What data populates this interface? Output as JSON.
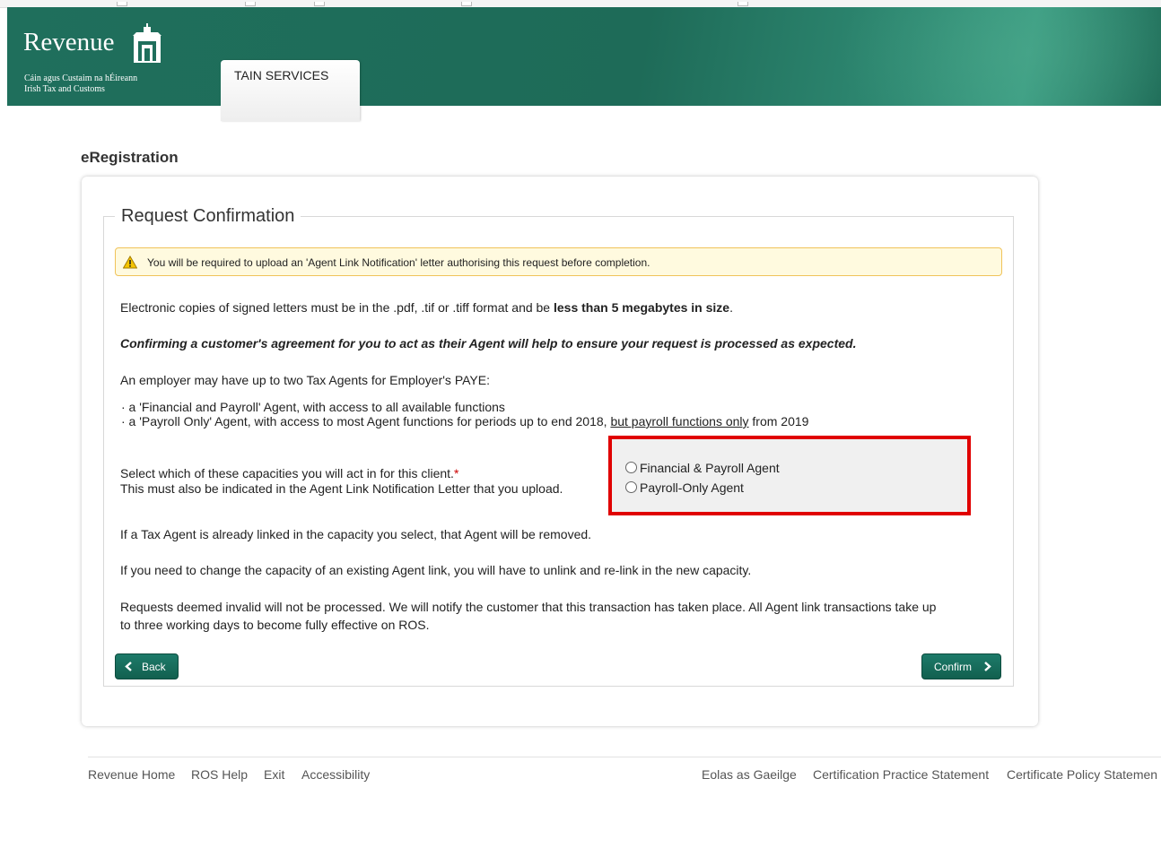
{
  "header": {
    "logo_word": "Revenue",
    "logo_sub1": "Cáin agus Custaim na hÉireann",
    "logo_sub2": "Irish Tax and Customs",
    "tab_label": "TAIN SERVICES"
  },
  "page": {
    "title": "eRegistration"
  },
  "form": {
    "legend": "Request Confirmation",
    "alert": "You will be required to upload an 'Agent Link Notification' letter authorising this request before completion.",
    "para1_a": "Electronic copies of signed letters must be in the .pdf, .tif or .tiff format and be ",
    "para1_b": "less than 5 megabytes in size",
    "para1_c": ".",
    "para2": "Confirming a customer's agreement for you to act as their Agent will help to ensure your request is processed as expected.",
    "para3": "An employer may have up to two Tax Agents for Employer's PAYE:",
    "bullet1": "· a 'Financial and Payroll' Agent, with access to all available functions",
    "bullet2_a": "· a 'Payroll Only' Agent, with access to most Agent functions for periods up to end 2018, ",
    "bullet2_b": "but payroll functions only",
    "bullet2_c": " from 2019",
    "select_label": "Select which of these capacities you will act in for this client.",
    "required_mark": "*",
    "select_label2": "This must also be indicated in the Agent Link Notification Letter that you upload.",
    "radio_options": [
      "Financial & Payroll Agent",
      "Payroll-Only Agent"
    ],
    "para4": "If a Tax Agent is already linked in the capacity you select, that Agent will be removed.",
    "para5": "If you need to change the capacity of an existing Agent link, you will have to unlink and re-link in the new capacity.",
    "para6_line1": "Requests deemed invalid will not be processed. We will notify the customer that this transaction has taken place. All Agent link transactions take up",
    "para6_line2": "to three working days to become fully effective on ROS.",
    "back_label": "Back",
    "confirm_label": "Confirm"
  },
  "footer": {
    "left_links": [
      "Revenue Home",
      "ROS Help",
      "Exit",
      "Accessibility"
    ],
    "right_links": [
      "Eolas as Gaeilge",
      "Certification Practice Statement",
      "Certificate Policy Statemen"
    ]
  },
  "colors": {
    "header_green": "#1f6f5c",
    "button_green": "#12604f",
    "highlight_red": "#e00000",
    "alert_bg": "#fffadf",
    "required_red": "#cc0000"
  }
}
